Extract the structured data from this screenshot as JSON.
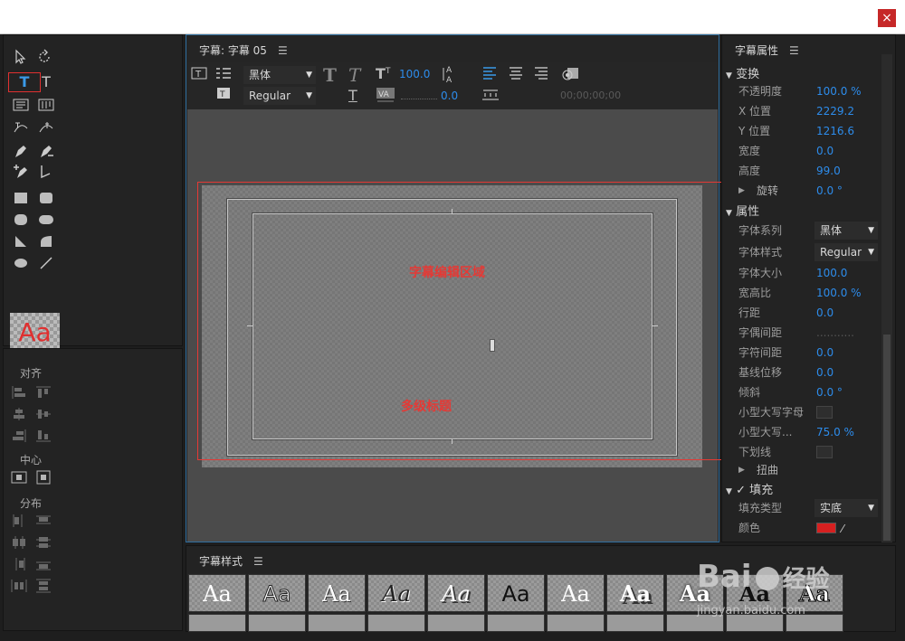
{
  "window": {
    "close_glyph": "×"
  },
  "editor": {
    "title": "字幕: 字幕 05",
    "menu_glyph": "☰",
    "font_family": "黑体",
    "font_style": "Regular",
    "font_size": "100.0",
    "kerning": "0.0",
    "timecode": "00;00;00;00",
    "label_subtitle_area": "字幕编辑区域",
    "label_multilevel": "多级标题"
  },
  "align_panel": {
    "align": "对齐",
    "center": "中心",
    "distribute": "分布"
  },
  "tools": {
    "sample": "Aa"
  },
  "props": {
    "title": "字幕属性",
    "menu_glyph": "☰",
    "transform": "变换",
    "opacity_l": "不透明度",
    "opacity_v": "100.0 %",
    "x_l": "X 位置",
    "x_v": "2229.2",
    "y_l": "Y 位置",
    "y_v": "1216.6",
    "w_l": "宽度",
    "w_v": "0.0",
    "h_l": "高度",
    "h_v": "99.0",
    "rot_l": "旋转",
    "rot_v": "0.0 °",
    "attrs": "属性",
    "family_l": "字体系列",
    "family_v": "黑体",
    "style_l": "字体样式",
    "style_v": "Regular",
    "size_l": "字体大小",
    "size_v": "100.0",
    "aspect_l": "宽高比",
    "aspect_v": "100.0 %",
    "lead_l": "行距",
    "lead_v": "0.0",
    "kern_l": "字偶间距",
    "kern_v": "...........",
    "track_l": "字符间距",
    "track_v": "0.0",
    "base_l": "基线位移",
    "base_v": "0.0",
    "slant_l": "倾斜",
    "slant_v": "0.0 °",
    "smallcaps_l": "小型大写字母",
    "smallcapsz_l": "小型大写...",
    "smallcapsz_v": "75.0 %",
    "underline_l": "下划线",
    "distort": "扭曲",
    "fill": "填充",
    "filltype_l": "填充类型",
    "filltype_v": "实底",
    "color_l": "颜色",
    "fill_color": "#d62020"
  },
  "styles": {
    "title": "字幕样式",
    "menu_glyph": "☰",
    "sample": "Aa"
  },
  "watermark": {
    "brand": "Bai",
    "brand2": "经验",
    "url": "jingyan.baidu.com"
  }
}
